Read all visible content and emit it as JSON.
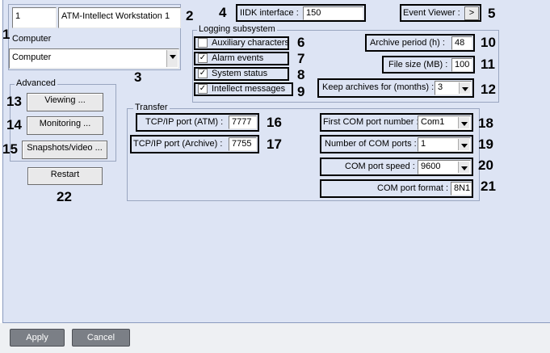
{
  "computer": {
    "id_value": "1",
    "name_value": "ATM-Intellect Workstation 1",
    "label": "Computer",
    "selected": "Computer"
  },
  "iidk": {
    "label": "IIDK interface :",
    "value": "150"
  },
  "event_viewer": {
    "label": "Event Viewer :",
    "button": ">"
  },
  "logging": {
    "title": "Logging subsystem",
    "auxiliary": {
      "label": "Auxiliary characters",
      "checked": false
    },
    "alarm": {
      "label": "Alarm events",
      "checked": true
    },
    "system": {
      "label": "System status",
      "checked": true
    },
    "intellect": {
      "label": "Intellect messages",
      "checked": true
    },
    "archive_period": {
      "label": "Archive period (h) :",
      "value": "48"
    },
    "file_size": {
      "label": "File size (MB) :",
      "value": "100"
    },
    "keep_archives": {
      "label": "Keep archives for (months) :",
      "value": "3"
    }
  },
  "advanced": {
    "title": "Advanced",
    "viewing": "Viewing ...",
    "monitoring": "Monitoring ...",
    "snapshots": "Snapshots/video ..."
  },
  "restart": "Restart",
  "transfer": {
    "title": "Transfer",
    "tcp_atm": {
      "label": "TCP/IP port (ATM) :",
      "value": "7777"
    },
    "tcp_archive": {
      "label": "TCP/IP port (Archive) :",
      "value": "7755"
    },
    "first_com": {
      "label": "First COM port number :",
      "value": "Com1"
    },
    "num_com": {
      "label": "Number of COM ports :",
      "value": "1"
    },
    "com_speed": {
      "label": "COM port speed :",
      "value": "9600"
    },
    "com_format": {
      "label": "COM port format :",
      "value": "8N1"
    }
  },
  "numbers": [
    "1",
    "2",
    "3",
    "4",
    "5",
    "6",
    "7",
    "8",
    "9",
    "10",
    "11",
    "12",
    "13",
    "14",
    "15",
    "16",
    "17",
    "18",
    "19",
    "20",
    "21",
    "22"
  ],
  "footer": {
    "apply": "Apply",
    "cancel": "Cancel"
  }
}
